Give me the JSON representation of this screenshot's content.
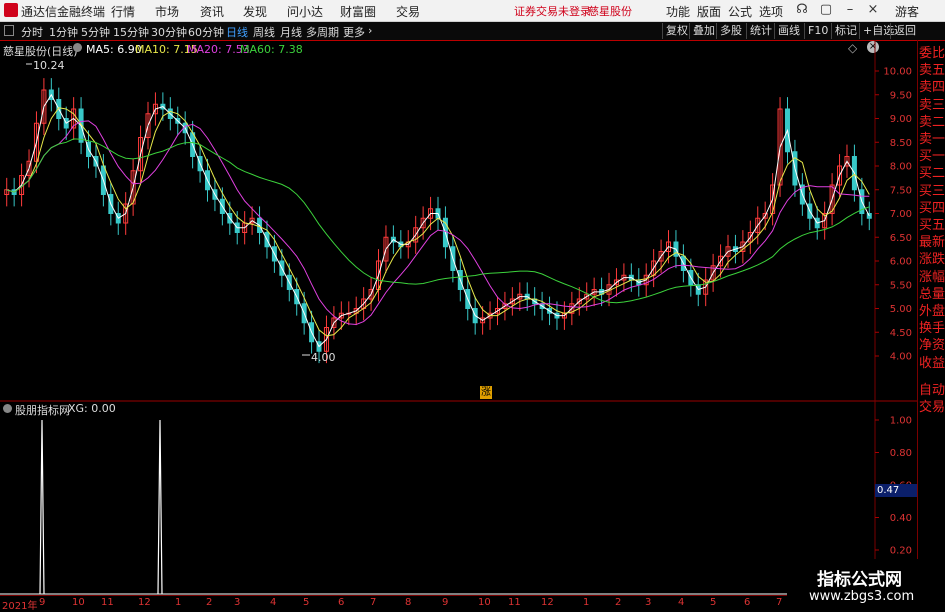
{
  "app": {
    "title": "通达信金融终端"
  },
  "menu": [
    "行情",
    "市场",
    "资讯",
    "发现",
    "问小达",
    "财富圈",
    "交易"
  ],
  "status": {
    "trade_notice": "证券交易未登录",
    "stock": "慈星股份"
  },
  "right_menu": [
    "功能",
    "版面",
    "公式",
    "选项"
  ],
  "guest": "游客",
  "periods": [
    "分时",
    "1分钟",
    "5分钟",
    "15分钟",
    "30分钟",
    "60分钟",
    "日线",
    "周线",
    "月线",
    "多周期",
    "更多"
  ],
  "active_period": "日线",
  "tools": [
    "复权",
    "叠加",
    "多股",
    "统计",
    "画线",
    "F10",
    "标记",
    "+自选",
    "返回"
  ],
  "main_chart": {
    "name": "慈星股份(日线)",
    "ma": [
      {
        "label": "MA5: 6.90",
        "color": "#ffffff"
      },
      {
        "label": "MA10: 7.15",
        "color": "#e8e84a"
      },
      {
        "label": "MA20: 7.53",
        "color": "#e040e0"
      },
      {
        "label": "MA60: 7.38",
        "color": "#3cd23c"
      }
    ],
    "high_label": "10.24",
    "low_label": "4.00",
    "marker": "涨",
    "y_ticks": [
      "10.00",
      "9.50",
      "9.00",
      "8.50",
      "8.00",
      "7.50",
      "7.00",
      "6.50",
      "6.00",
      "5.50",
      "5.00",
      "4.50",
      "4.00"
    ]
  },
  "indicator": {
    "name": "股朋指标网",
    "value_label": "XG: 0.00",
    "y_ticks": [
      "1.00",
      "0.80",
      "0.60",
      "0.40",
      "0.20"
    ],
    "current_value": "0.47"
  },
  "side_panel": [
    "委比",
    "卖五",
    "卖四",
    "卖三",
    "卖二",
    "卖一",
    "买一",
    "买二",
    "买三",
    "买四",
    "买五",
    "最新",
    "涨跌",
    "涨幅",
    "总量",
    "外盘",
    "换手",
    "净资",
    "收益",
    "自动",
    "交易"
  ],
  "x_labels": [
    "2021年",
    "9",
    "10",
    "11",
    "12",
    "1",
    "2",
    "3",
    "4",
    "5",
    "6",
    "7",
    "8",
    "9",
    "10",
    "11",
    "12",
    "1",
    "2",
    "3",
    "4",
    "5",
    "6",
    "7"
  ],
  "watermark": {
    "title": "指标公式网",
    "url": "www.zbgs3.com"
  },
  "colors": {
    "up": "#ff3b3b",
    "down": "#38c8c8",
    "grid": "#7a0000",
    "axis": "#d33"
  },
  "chart_data": {
    "type": "line",
    "series_closes": [
      7.5,
      7.4,
      7.8,
      8.1,
      8.9,
      9.6,
      9.4,
      9.0,
      8.8,
      9.2,
      8.5,
      8.2,
      8.0,
      7.4,
      7.0,
      6.8,
      7.2,
      7.9,
      8.6,
      9.1,
      9.3,
      9.2,
      9.0,
      8.9,
      8.7,
      8.2,
      7.9,
      7.5,
      7.3,
      7.0,
      6.8,
      6.6,
      6.8,
      6.9,
      6.6,
      6.3,
      6.0,
      5.7,
      5.4,
      5.1,
      4.7,
      4.3,
      4.1,
      4.6,
      4.8,
      4.9,
      4.9,
      5.0,
      5.2,
      5.4,
      6.0,
      6.5,
      6.4,
      6.3,
      6.4,
      6.7,
      6.9,
      7.1,
      6.9,
      6.3,
      5.8,
      5.4,
      5.0,
      4.7,
      4.8,
      4.9,
      5.0,
      5.1,
      5.2,
      5.3,
      5.2,
      5.1,
      5.0,
      4.9,
      4.8,
      4.9,
      5.1,
      5.2,
      5.3,
      5.4,
      5.3,
      5.5,
      5.6,
      5.7,
      5.6,
      5.5,
      5.7,
      6.0,
      6.2,
      6.4,
      6.1,
      5.8,
      5.5,
      5.3,
      5.6,
      5.9,
      6.1,
      6.3,
      6.2,
      6.4,
      6.6,
      6.9,
      7.0,
      7.6,
      9.2,
      8.3,
      7.6,
      7.2,
      6.9,
      6.7,
      7.0,
      7.6,
      8.0,
      8.2,
      7.5,
      7.0,
      6.9
    ],
    "y_range": [
      4.0,
      10.24
    ],
    "indicator_spikes": [
      {
        "position": 9,
        "value": 1.0
      },
      {
        "position": 30,
        "value": 1.0
      }
    ]
  }
}
